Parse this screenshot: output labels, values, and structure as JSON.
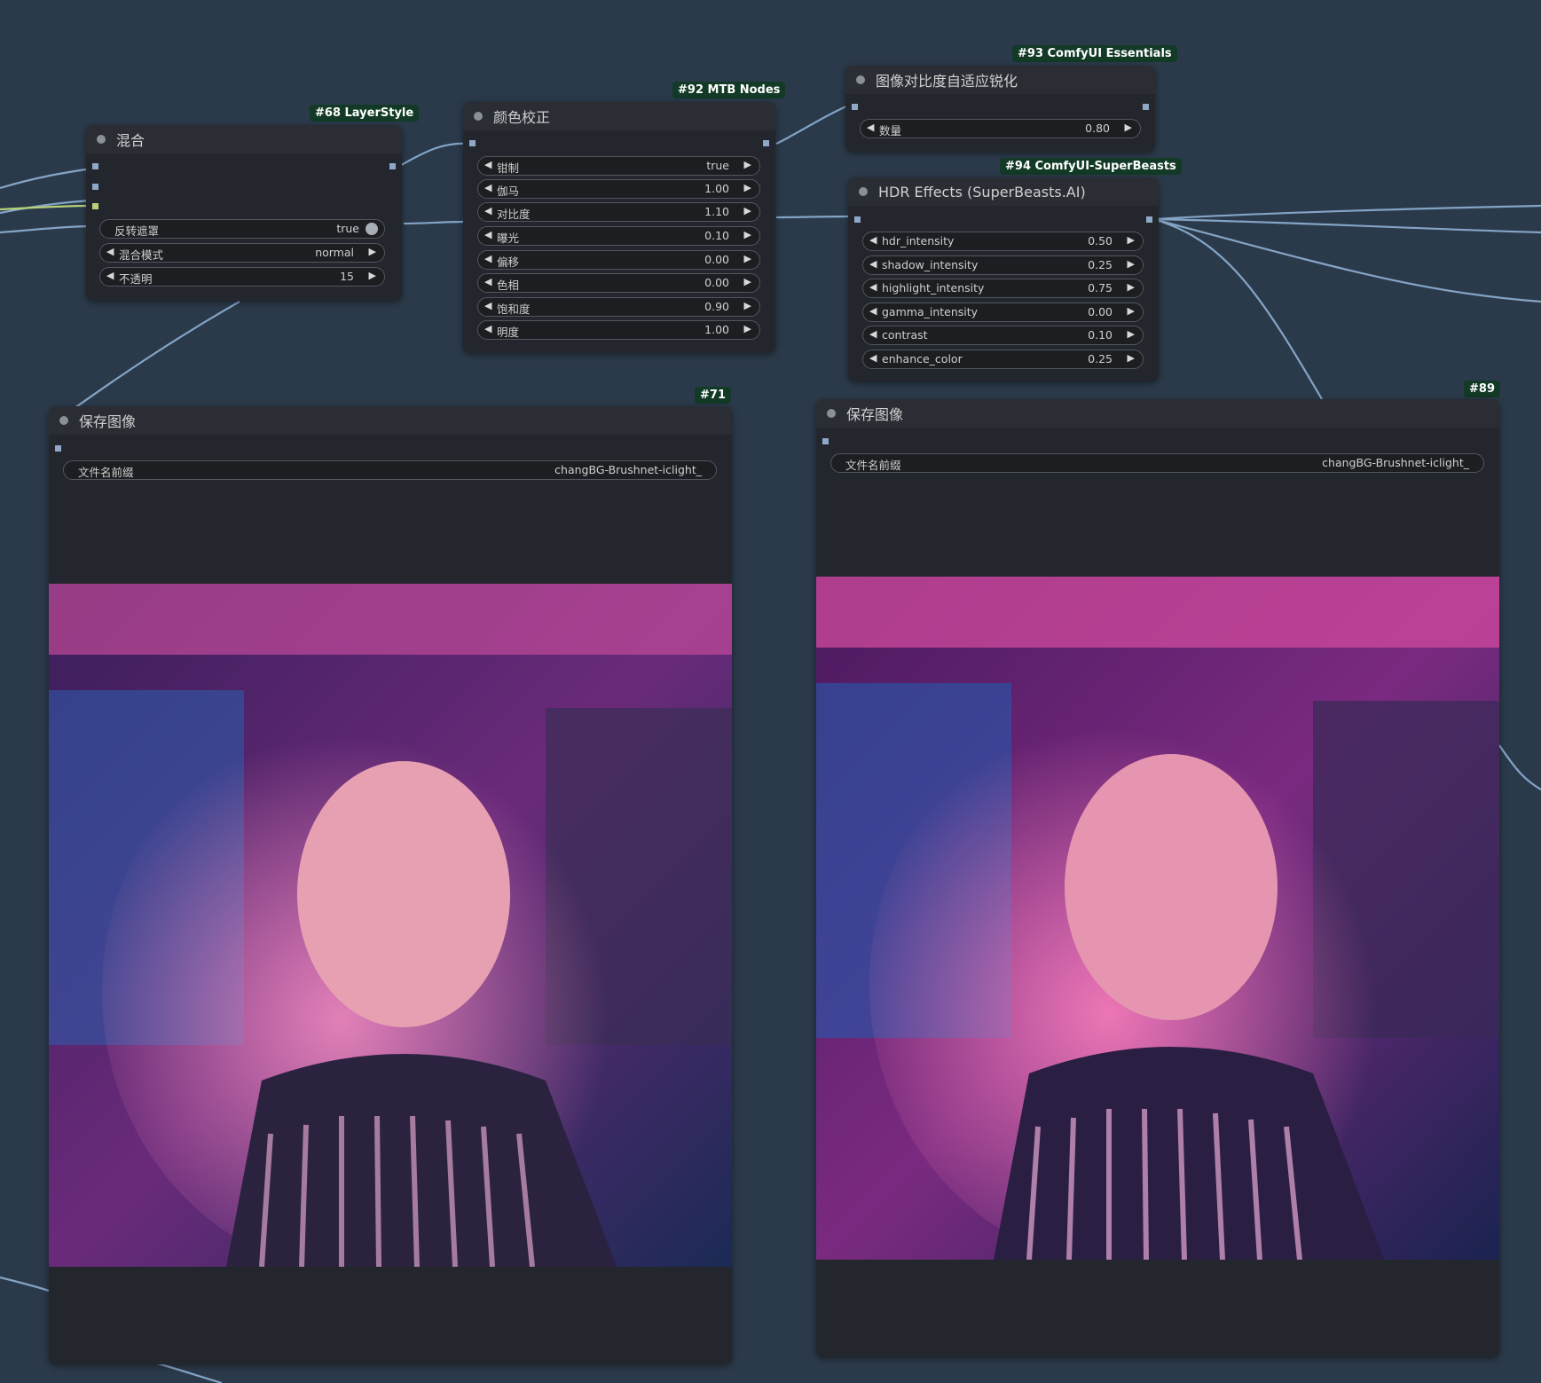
{
  "nodes": {
    "blend": {
      "badge": "#68 LayerStyle",
      "title": "混合",
      "widgets": [
        {
          "label": "反转遮罩",
          "value": "true"
        },
        {
          "label": "混合模式",
          "value": "normal"
        },
        {
          "label": "不透明",
          "value": "15"
        }
      ]
    },
    "color_correct": {
      "badge": "#92 MTB Nodes",
      "title": "颜色校正",
      "widgets": [
        {
          "label": "钳制",
          "value": "true"
        },
        {
          "label": "伽马",
          "value": "1.00"
        },
        {
          "label": "对比度",
          "value": "1.10"
        },
        {
          "label": "曝光",
          "value": "0.10"
        },
        {
          "label": "偏移",
          "value": "0.00"
        },
        {
          "label": "色相",
          "value": "0.00"
        },
        {
          "label": "饱和度",
          "value": "0.90"
        },
        {
          "label": "明度",
          "value": "1.00"
        }
      ]
    },
    "sharpen": {
      "badge": "#93 ComfyUI Essentials",
      "title": "图像对比度自适应锐化",
      "widgets": [
        {
          "label": "数量",
          "value": "0.80"
        }
      ]
    },
    "hdr": {
      "badge": "#94 ComfyUI-SuperBeasts",
      "title": "HDR Effects (SuperBeasts.AI)",
      "widgets": [
        {
          "label": "hdr_intensity",
          "value": "0.50"
        },
        {
          "label": "shadow_intensity",
          "value": "0.25"
        },
        {
          "label": "highlight_intensity",
          "value": "0.75"
        },
        {
          "label": "gamma_intensity",
          "value": "0.00"
        },
        {
          "label": "contrast",
          "value": "0.10"
        },
        {
          "label": "enhance_color",
          "value": "0.25"
        }
      ]
    },
    "save_left": {
      "badge": "#71",
      "title": "保存图像",
      "prefix_label": "文件名前缀",
      "prefix_value": "changBG-Brushnet-iclight_"
    },
    "save_right": {
      "badge": "#89",
      "title": "保存图像",
      "prefix_label": "文件名前缀",
      "prefix_value": "changBG-Brushnet-iclight_"
    }
  },
  "colors": {
    "canvas": "#2b3a4a",
    "node_body": "#23262c",
    "node_header": "#2a2d34",
    "badge_bg": "#123a26",
    "wire": "#8eb0d4",
    "slot": "#8fa8c8"
  },
  "icons": {
    "decrement": "left-triangle-icon",
    "increment": "right-triangle-icon",
    "status": "node-status-dot-icon"
  }
}
